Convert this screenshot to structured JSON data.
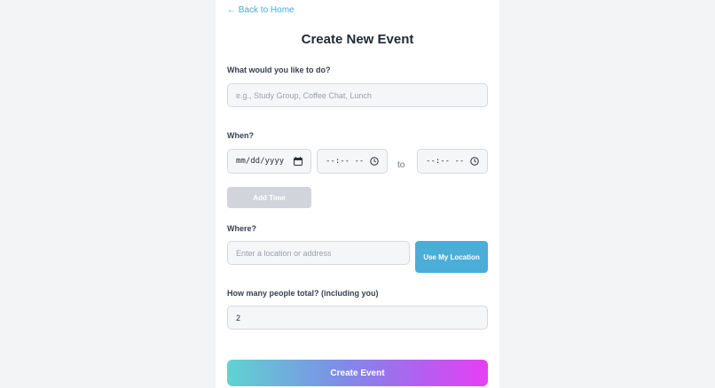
{
  "nav": {
    "back_label": "← Back to Home"
  },
  "page": {
    "title": "Create New Event"
  },
  "activity": {
    "label": "What would you like to do?",
    "placeholder": "e.g., Study Group, Coffee Chat, Lunch"
  },
  "when": {
    "label": "When?",
    "date_placeholder": "mm/dd/yyyy",
    "start_time_placeholder": "--:-- --",
    "end_time_placeholder": "--:-- --",
    "to_label": "to",
    "add_time_label": "Add Time"
  },
  "where": {
    "label": "Where?",
    "placeholder": "Enter a location or address",
    "use_location_label": "Use My Location"
  },
  "people": {
    "label": "How many people total? (including you)",
    "value": "2"
  },
  "submit": {
    "label": "Create Event"
  },
  "colors": {
    "accent": "#4aaed8",
    "gradient_start": "#5fd3d0",
    "gradient_end": "#e83ff5",
    "disabled": "#d1d5db"
  },
  "icons": {
    "date": "calendar-icon",
    "time": "clock-icon"
  }
}
